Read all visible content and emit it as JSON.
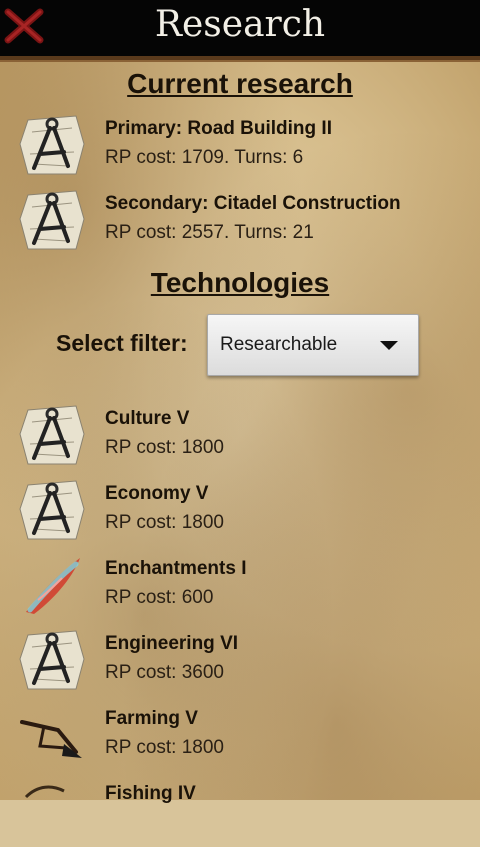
{
  "header": {
    "title": "Research",
    "close_icon": "close-x-icon"
  },
  "current": {
    "heading": "Current research",
    "items": [
      {
        "name": "Primary: Road Building II",
        "detail": "RP cost: 1709. Turns: 6",
        "icon": "compass-blueprint-icon"
      },
      {
        "name": "Secondary: Citadel Construction",
        "detail": "RP cost: 2557. Turns: 21",
        "icon": "compass-blueprint-icon"
      }
    ]
  },
  "technologies": {
    "heading": "Technologies",
    "filter_label": "Select filter:",
    "filter_value": "Researchable",
    "items": [
      {
        "name": "Culture V",
        "detail": "RP cost: 1800",
        "icon": "compass-blueprint-icon"
      },
      {
        "name": "Economy V",
        "detail": "RP cost: 1800",
        "icon": "compass-blueprint-icon"
      },
      {
        "name": "Enchantments I",
        "detail": "RP cost: 600",
        "icon": "enchanted-blade-icon"
      },
      {
        "name": "Engineering VI",
        "detail": "RP cost: 3600",
        "icon": "compass-blueprint-icon"
      },
      {
        "name": "Farming V",
        "detail": "RP cost: 1800",
        "icon": "plough-icon"
      },
      {
        "name": "Fishing IV",
        "detail": "",
        "icon": "fishing-icon"
      }
    ]
  },
  "colors": {
    "titlebar": "#050505",
    "close_x": "#8b1a1a",
    "text": "#1a1208"
  }
}
